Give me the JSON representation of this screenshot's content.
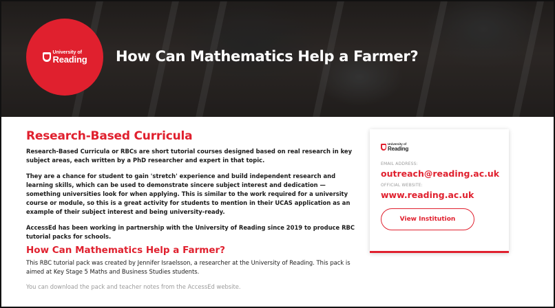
{
  "hero": {
    "logo_small": "University of",
    "logo_big": "Reading",
    "title": "How Can Mathematics Help a Farmer?"
  },
  "main": {
    "heading": "Research-Based Curricula",
    "paragraphs": [
      "Research-Based Curricula or RBCs are short tutorial courses designed based on real research in key subject areas, each written by a PhD researcher and expert in that topic.",
      "They are a chance for student to gain 'stretch' experience and build independent research and learning skills, which can be used to demonstrate sincere subject interest and dedication — something universities look for when applying. This is similar to the work required for a university course or module, so this is a great activity for students to mention in their UCAS application as an example of their subject interest and being university-ready.",
      "AccessEd has been working in partnership with the University of Reading since 2019 to produce RBC tutorial packs for schools."
    ],
    "subheading": "How Can Mathematics Help a Farmer?",
    "pack_text": "This RBC tutorial pack was created by Jennifer Israelsson, a researcher at the University of Reading. This pack is aimed at Key Stage 5 Maths and Business Studies students.",
    "faded_text": "You can download the pack and teacher notes from the AccessEd website."
  },
  "card": {
    "logo_small": "University of",
    "logo_big": "Reading",
    "email_label": "Email Address:",
    "email": "outreach@reading.ac.uk",
    "website_label": "Official Website:",
    "website": "www.reading.ac.uk",
    "button_label": "View Institution"
  },
  "colors": {
    "accent": "#e0202e"
  }
}
